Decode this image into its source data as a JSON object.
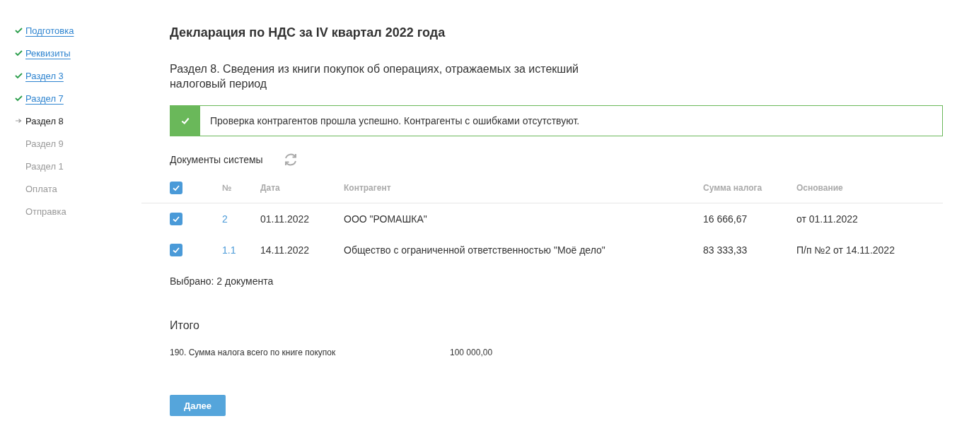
{
  "sidebar": {
    "items": [
      {
        "label": "Подготовка",
        "done": true,
        "selected": false
      },
      {
        "label": "Реквизиты",
        "done": true,
        "selected": false
      },
      {
        "label": "Раздел 3",
        "done": true,
        "selected": false
      },
      {
        "label": "Раздел 7",
        "done": true,
        "selected": false
      },
      {
        "label": "Раздел 8",
        "done": false,
        "selected": true
      },
      {
        "label": "Раздел 9",
        "done": false,
        "selected": false
      },
      {
        "label": "Раздел 1",
        "done": false,
        "selected": false
      },
      {
        "label": "Оплата",
        "done": false,
        "selected": false
      },
      {
        "label": "Отправка",
        "done": false,
        "selected": false
      }
    ]
  },
  "title": "Декларация по НДС за IV квартал 2022 года",
  "subtitle": "Раздел 8. Сведения из книги покупок об операциях, отражаемых за истекший налоговый период",
  "alert": {
    "kind": "success",
    "text": "Проверка контрагентов прошла успешно. Контрагенты с ошибками отсутствуют."
  },
  "documents_title": "Документы системы",
  "table": {
    "all_checked": true,
    "columns": [
      "№",
      "Дата",
      "Контрагент",
      "Сумма налога",
      "Основание"
    ],
    "rows": [
      {
        "checked": true,
        "number": "2",
        "date": "01.11.2022",
        "counterparty": "ООО \"РОМАШКА\"",
        "tax": "16 666,67",
        "basis": "от 01.11.2022"
      },
      {
        "checked": true,
        "number": "1.1",
        "date": "14.11.2022",
        "counterparty": "Общество с ограниченной ответственностью \"Моё дело\"",
        "tax": "83 333,33",
        "basis": "П/п №2 от 14.11.2022"
      }
    ]
  },
  "selected_count": "Выбрано: 2 документа",
  "totals": {
    "title": "Итого",
    "rows": [
      {
        "label": "190. Сумма налога всего по книге покупок",
        "value": "100 000,00"
      }
    ]
  },
  "next_button": "Далее"
}
